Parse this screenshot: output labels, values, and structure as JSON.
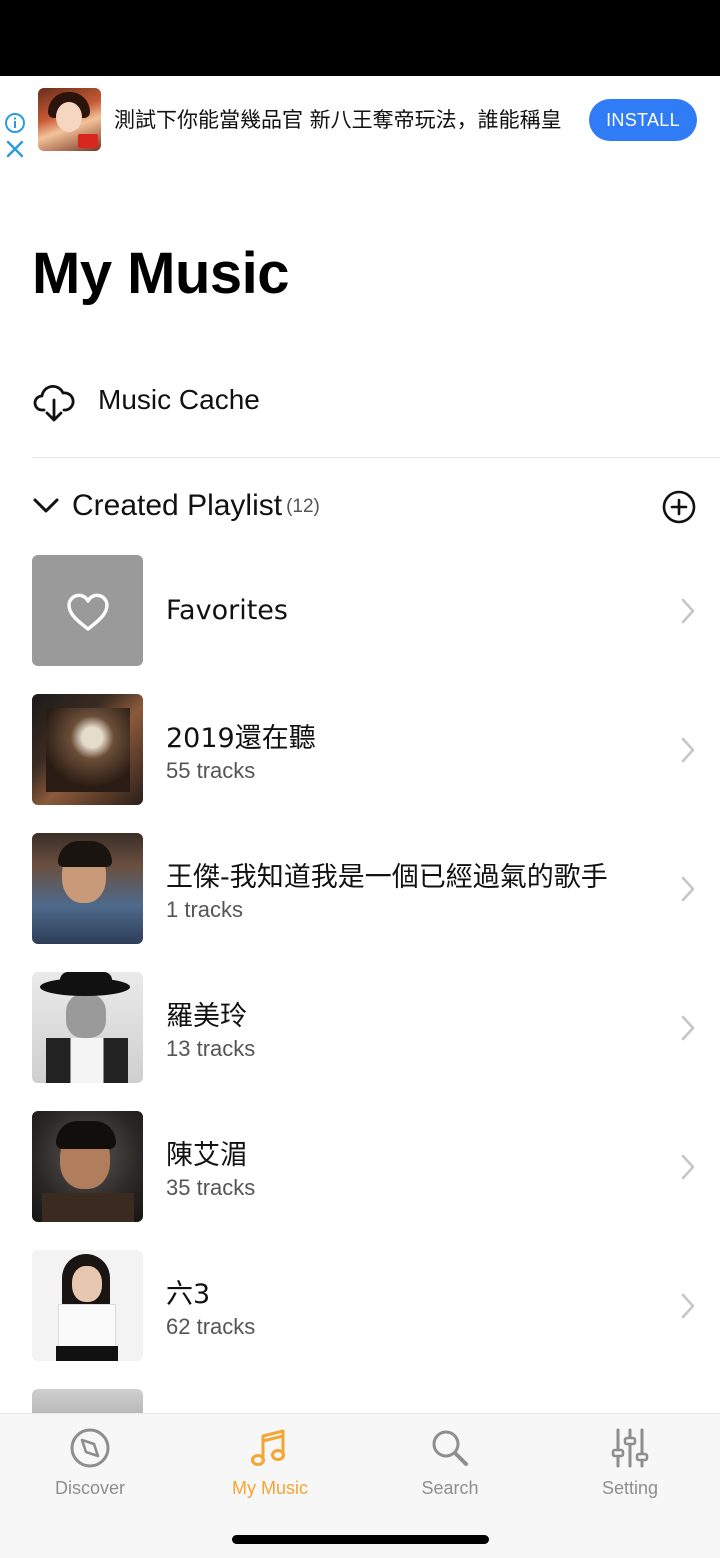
{
  "ad": {
    "text": "測試下你能當幾品官 新八王奪帝玩法，誰能稱皇",
    "install_label": "INSTALL",
    "accent": "#2f7cf6"
  },
  "header": {
    "title": "My Music"
  },
  "cache": {
    "label": "Music Cache",
    "icon": "cloud-download-icon"
  },
  "created_playlist": {
    "title": "Created Playlist",
    "count": "(12)"
  },
  "playlists": [
    {
      "name": "Favorites",
      "tracks": ""
    },
    {
      "name": "2019還在聽",
      "tracks": "55 tracks"
    },
    {
      "name": "王傑-我知道我是一個已經過氣的歌手",
      "tracks": "1 tracks"
    },
    {
      "name": "羅美玲",
      "tracks": "13 tracks"
    },
    {
      "name": "陳艾湄",
      "tracks": "35 tracks"
    },
    {
      "name": "六3",
      "tracks": "62 tracks"
    }
  ],
  "tabs": [
    {
      "label": "Discover",
      "icon": "compass-icon"
    },
    {
      "label": "My Music",
      "icon": "music-note-icon",
      "active": true
    },
    {
      "label": "Search",
      "icon": "search-icon"
    },
    {
      "label": "Setting",
      "icon": "sliders-icon"
    }
  ],
  "colors": {
    "active_tab": "#f5a531",
    "inactive_tab": "#8e8e8e"
  }
}
